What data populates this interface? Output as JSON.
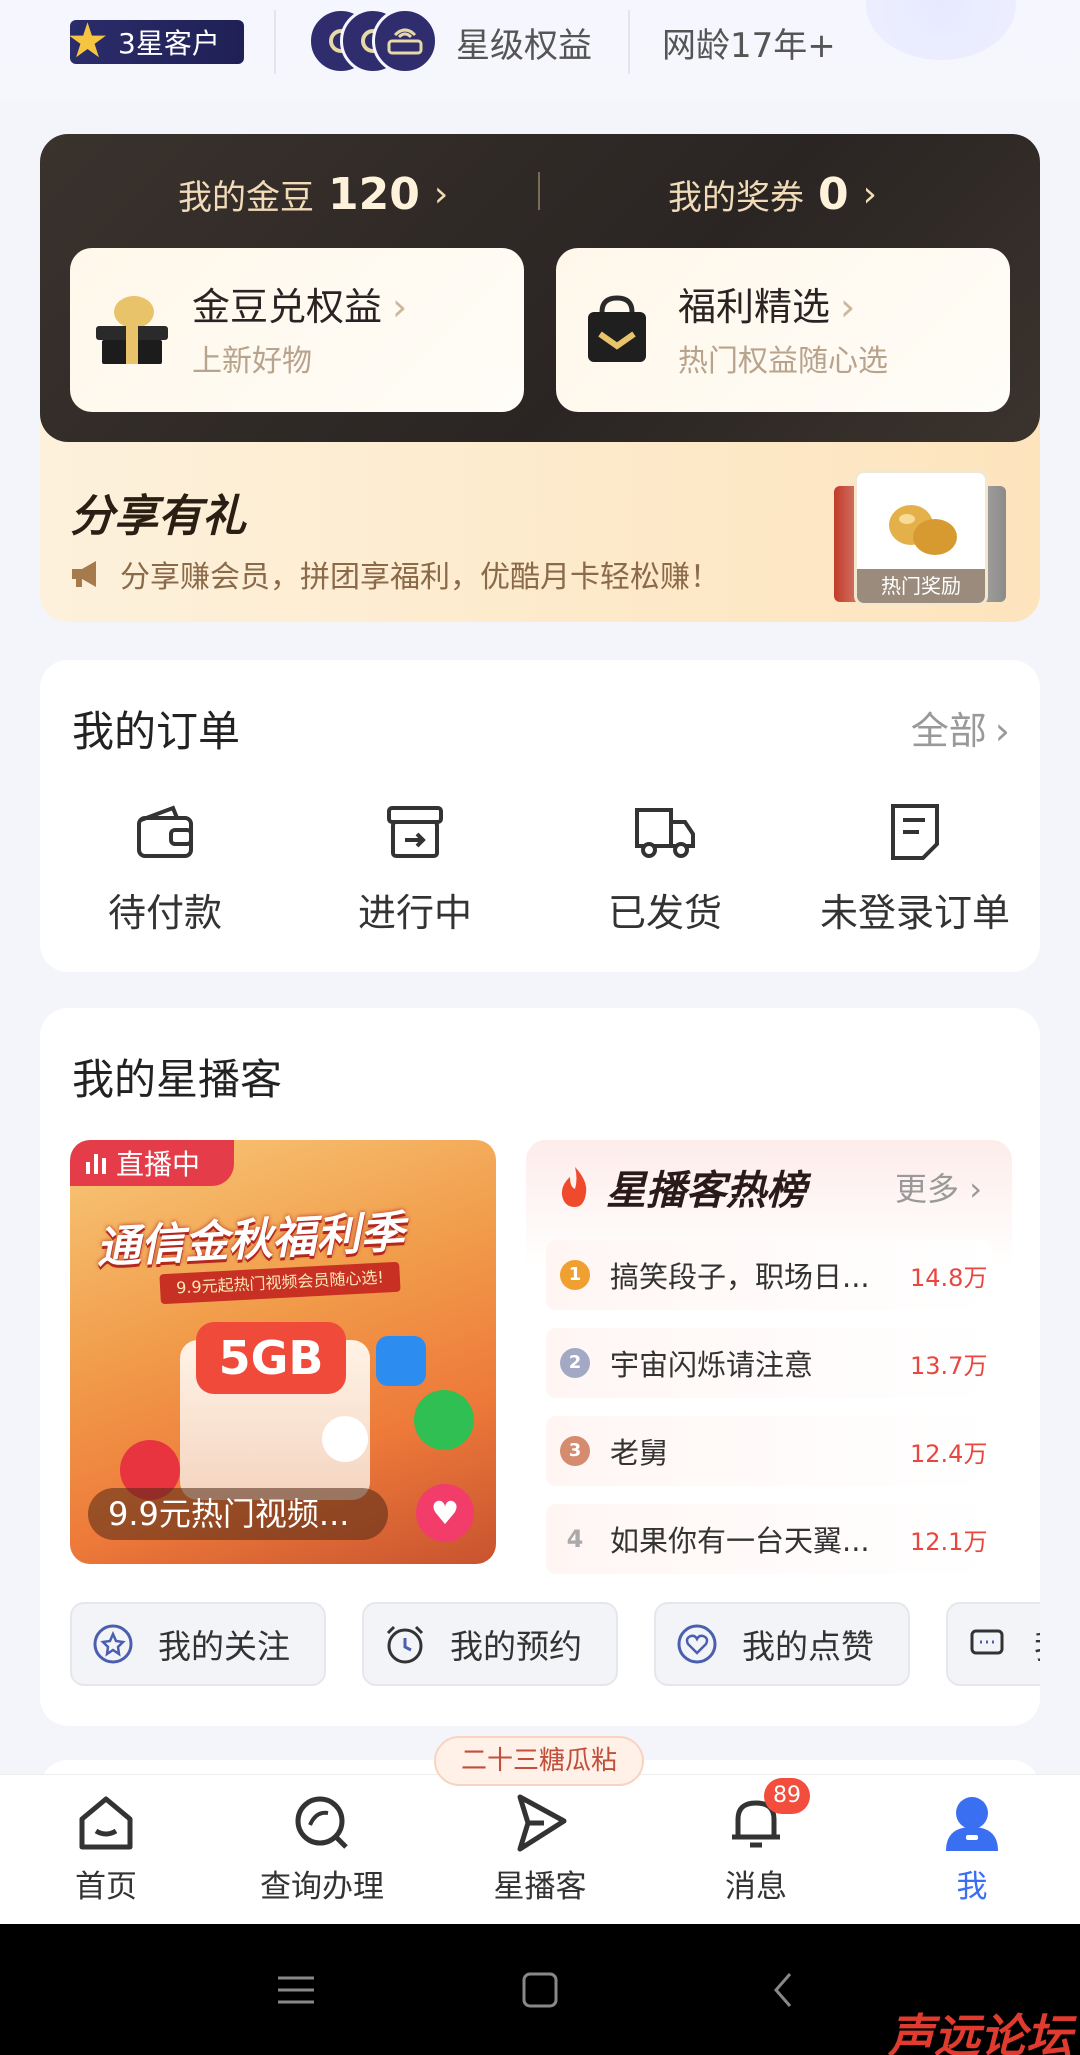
{
  "top_bar": {
    "level_badge": "3星客户",
    "star_rights": "星级权益",
    "network_age": "网龄17年+"
  },
  "gold_card": {
    "beans_label": "我的金豆",
    "beans_value": "120",
    "coupons_label": "我的奖券",
    "coupons_value": "0",
    "cards": [
      {
        "title": "金豆兑权益",
        "subtitle": "上新好物"
      },
      {
        "title": "福利精选",
        "subtitle": "热门权益随心选"
      }
    ]
  },
  "share": {
    "title": "分享有礼",
    "subtitle": "分享赚会员，拼团享福利，优酷月卡轻松赚！",
    "reward_tag": "热门奖励"
  },
  "orders": {
    "title": "我的订单",
    "all_label": "全部",
    "items": [
      {
        "label": "待付款",
        "icon": "wallet-icon"
      },
      {
        "label": "进行中",
        "icon": "box-arrow-icon"
      },
      {
        "label": "已发货",
        "icon": "truck-icon"
      },
      {
        "label": "未登录订单",
        "icon": "document-icon"
      }
    ]
  },
  "xingboke": {
    "title": "我的星播客",
    "live": {
      "tag": "直播中",
      "headline": "通信金秋福利季",
      "subline": "9.9元起热门视频会员随心选!",
      "gift_text": "5GB",
      "caption": "9.9元热门视频..."
    },
    "hot_list": {
      "title": "星播客热榜",
      "more_label": "更多",
      "items": [
        {
          "rank": "1",
          "name": "搞笑段子，职场日...",
          "count": "14.8万"
        },
        {
          "rank": "2",
          "name": "宇宙闪烁请注意",
          "count": "13.7万"
        },
        {
          "rank": "3",
          "name": "老舅",
          "count": "12.4万"
        },
        {
          "rank": "4",
          "name": "如果你有一台天翼...",
          "count": "12.1万"
        }
      ]
    },
    "chips": [
      {
        "label": "我的关注",
        "icon": "star-icon"
      },
      {
        "label": "我的预约",
        "icon": "alarm-clock-icon"
      },
      {
        "label": "我的点赞",
        "icon": "heart-icon"
      },
      {
        "label": "我",
        "icon": "comment-icon"
      }
    ]
  },
  "tab_bar": {
    "promo": "二十三糖瓜粘",
    "notification_count": "89",
    "tabs": [
      {
        "label": "首页",
        "icon": "home-icon"
      },
      {
        "label": "查询办理",
        "icon": "search-icon"
      },
      {
        "label": "星播客",
        "icon": "play-icon"
      },
      {
        "label": "消息",
        "icon": "bell-icon"
      },
      {
        "label": "我",
        "icon": "user-icon"
      }
    ],
    "active_color": "#3a6ff2"
  },
  "watermark": "声远论坛"
}
